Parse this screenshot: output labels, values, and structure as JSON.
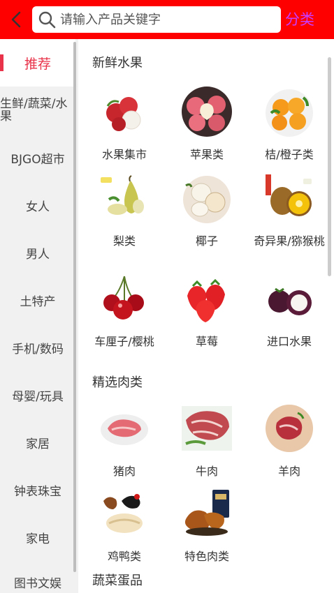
{
  "header": {
    "search_placeholder": "请输入产品关键字",
    "category_label": "分类"
  },
  "sidebar": {
    "items": [
      {
        "label": "推荐"
      },
      {
        "label": "生鲜/蔬菜/水果"
      },
      {
        "label": "BJGO超市"
      },
      {
        "label": "女人"
      },
      {
        "label": "男人"
      },
      {
        "label": "土特产"
      },
      {
        "label": "手机/数码"
      },
      {
        "label": "母婴/玩具"
      },
      {
        "label": "家居"
      },
      {
        "label": "钟表珠宝"
      },
      {
        "label": "家电"
      },
      {
        "label": "图书文娱"
      }
    ]
  },
  "sections": [
    {
      "title": "新鲜水果",
      "products": [
        {
          "label": "水果集市",
          "icon": "lychee-icon"
        },
        {
          "label": "苹果类",
          "icon": "apple-icon"
        },
        {
          "label": "桔/橙子类",
          "icon": "orange-icon"
        },
        {
          "label": "梨类",
          "icon": "pear-icon"
        },
        {
          "label": "椰子",
          "icon": "coconut-icon"
        },
        {
          "label": "奇异果/猕猴桃",
          "icon": "kiwi-icon"
        },
        {
          "label": "车厘子/樱桃",
          "icon": "cherry-icon"
        },
        {
          "label": "草莓",
          "icon": "strawberry-icon"
        },
        {
          "label": "进口水果",
          "icon": "mangosteen-icon"
        }
      ]
    },
    {
      "title": "精选肉类",
      "products": [
        {
          "label": "猪肉",
          "icon": "pork-icon"
        },
        {
          "label": "牛肉",
          "icon": "beef-icon"
        },
        {
          "label": "羊肉",
          "icon": "mutton-icon"
        },
        {
          "label": "鸡鸭类",
          "icon": "poultry-icon"
        },
        {
          "label": "特色肉类",
          "icon": "specialty-meat-icon"
        }
      ]
    },
    {
      "title": "蔬菜蛋品",
      "products": []
    }
  ],
  "colors": {
    "header_bg": "#ff0000",
    "active_accent": "#e8334a",
    "category_text": "#c83cff",
    "sidebar_bg": "#f1f1f1"
  }
}
